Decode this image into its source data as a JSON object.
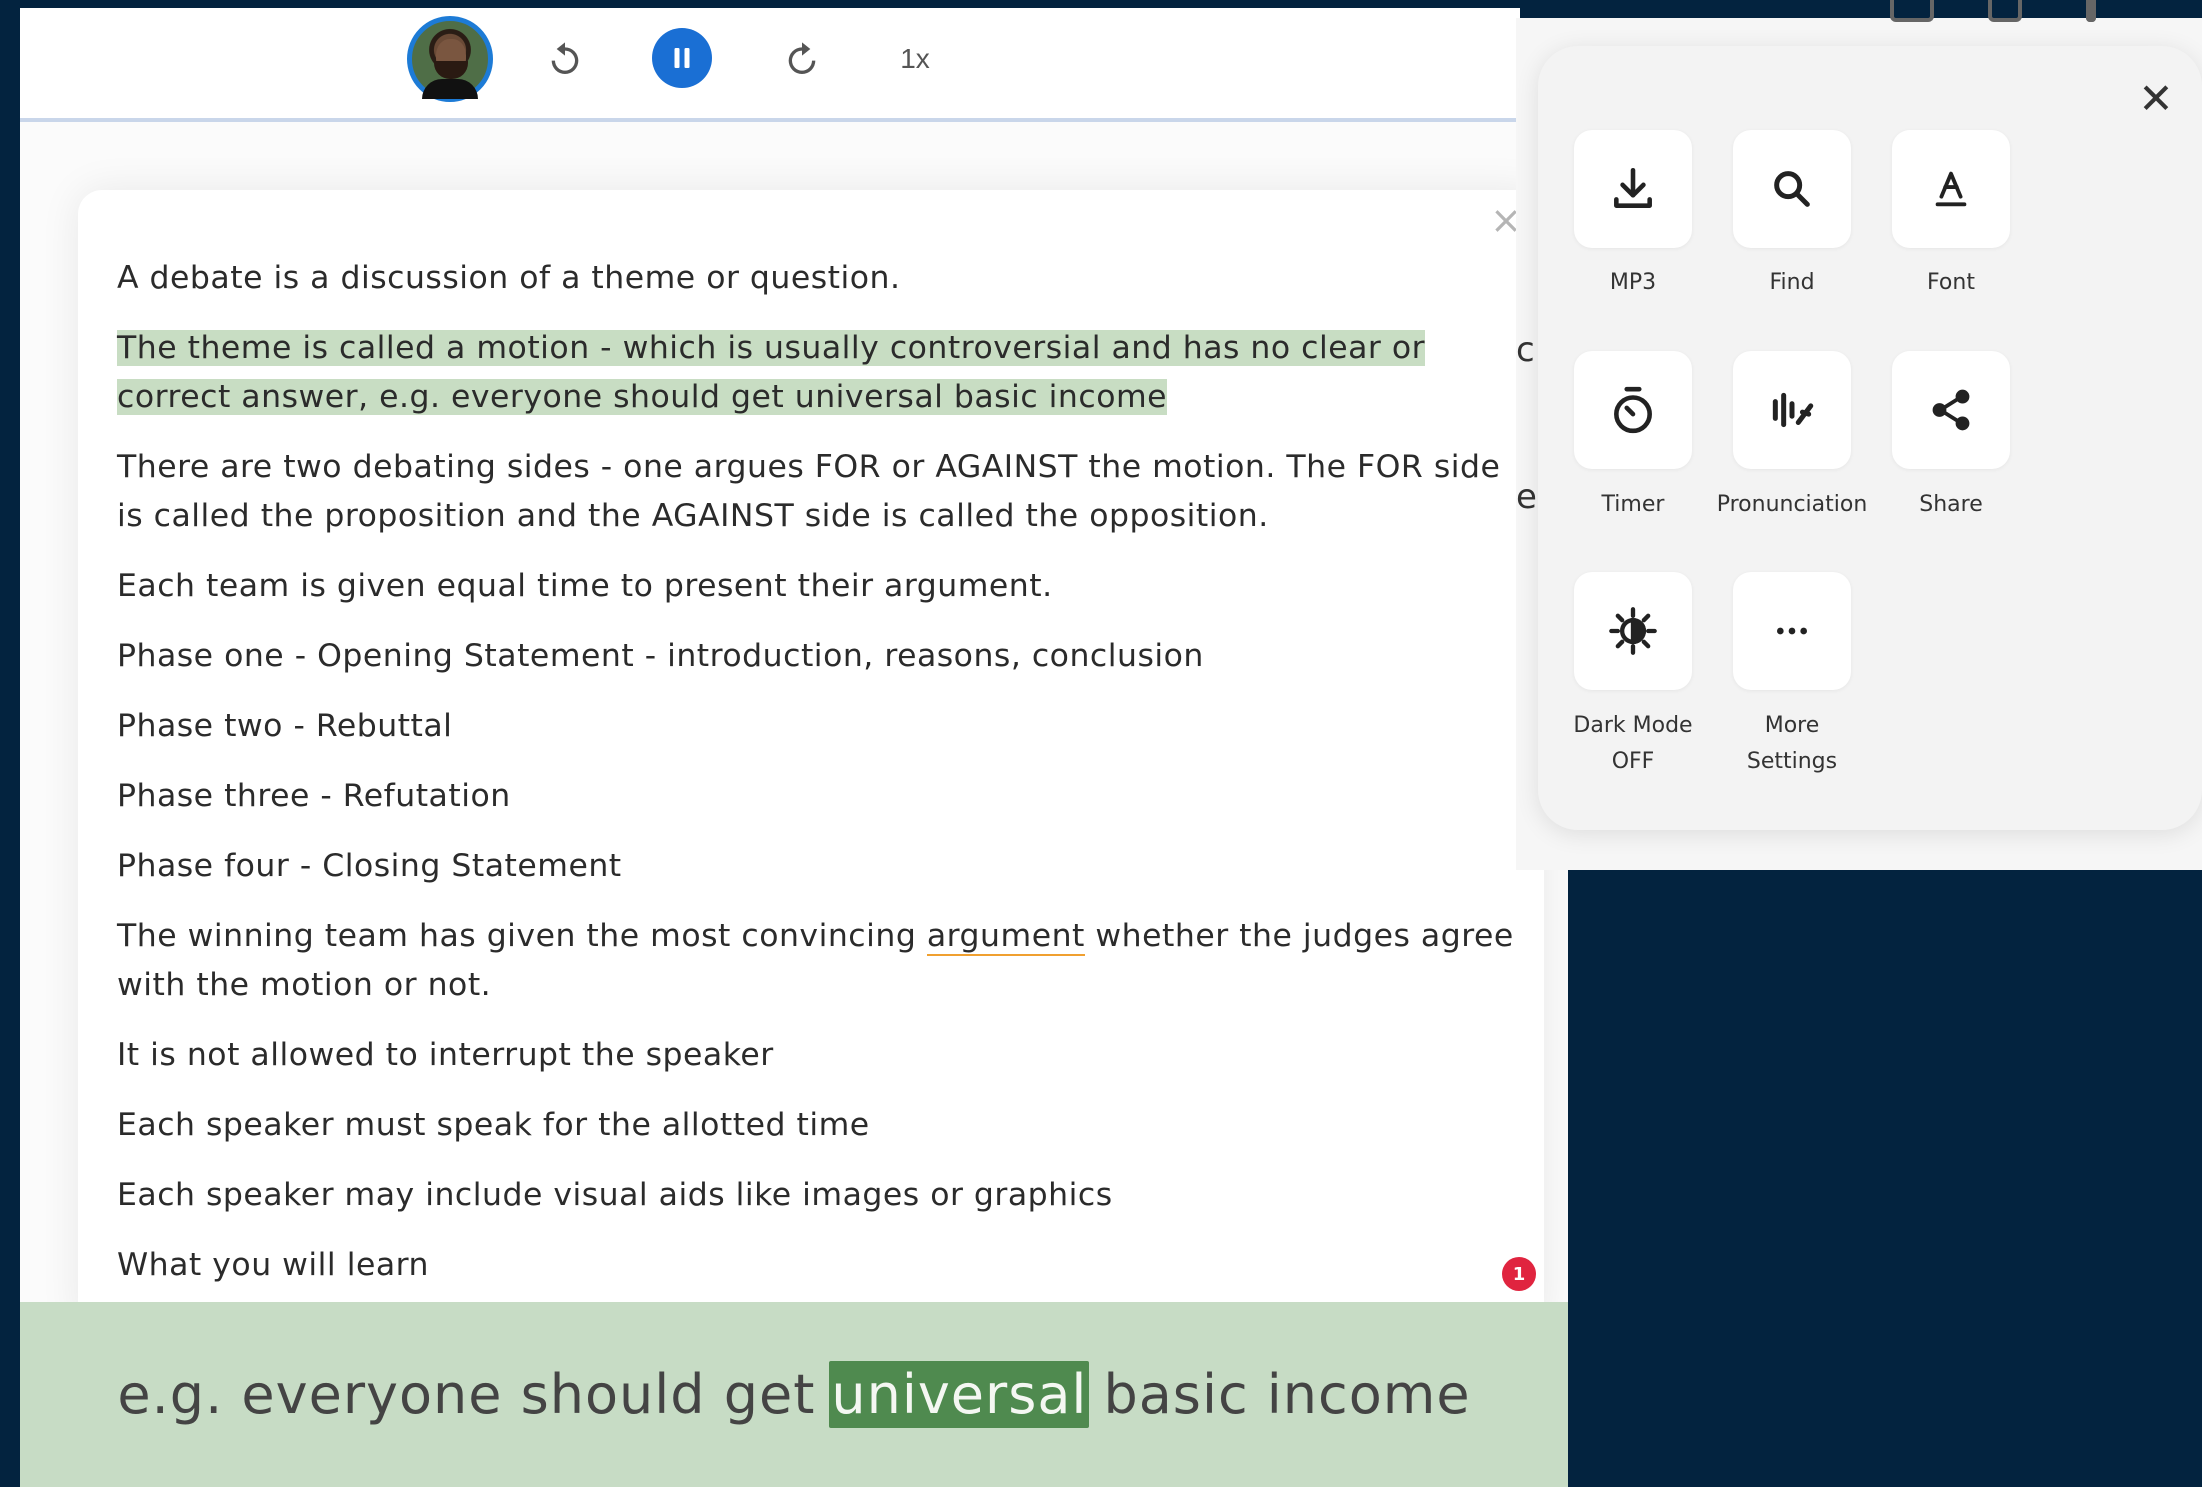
{
  "player": {
    "speed": "1x",
    "rewind": "rewind-icon",
    "play_pause": "pause-icon",
    "forward": "forward-icon"
  },
  "card": {
    "paragraphs": [
      "A debate is a discussion of a theme or question.",
      "The theme is called a motion - which is usually controversial and has no clear or correct answer, e.g. everyone should get universal basic income",
      "There are two debating sides - one argues FOR or AGAINST the motion. The FOR side is called the proposition and the AGAINST side is called the opposition.",
      "Each team is given equal time to present their argument.",
      "Phase one - Opening Statement - introduction, reasons, conclusion",
      "Phase two - Rebuttal",
      "Phase three - Refutation",
      "Phase four - Closing Statement",
      "The winning team has given the most convincing",
      "argument",
      "whether the judges agree with the motion or not.",
      "It is not allowed to interrupt the speaker",
      "Each speaker must speak for the allotted time",
      "Each speaker may include visual aids like images or graphics",
      "What you will learn"
    ],
    "highlight_line1": "The theme is called a motion - which is usually controversial and has no clear or",
    "highlight_line2": "correct answer, e.g. everyone should get universal basic income",
    "notification_count": "1",
    "peek_char_1": "c",
    "peek_char_2": "e"
  },
  "caption": {
    "before": "e.g. everyone should get",
    "current_word": "universal",
    "after": "basic income"
  },
  "panel": {
    "items": [
      {
        "label": "MP3",
        "icon": "download-icon"
      },
      {
        "label": "Find",
        "icon": "search-icon"
      },
      {
        "label": "Font",
        "icon": "font-icon"
      },
      {
        "label": "Timer",
        "icon": "timer-icon"
      },
      {
        "label": "Pronunciation",
        "icon": "pronunciation-icon"
      },
      {
        "label": "Share",
        "icon": "share-icon"
      },
      {
        "label_line1": "Dark Mode",
        "label_line2": "OFF",
        "icon": "dark-mode-icon"
      },
      {
        "label_line1": "More",
        "label_line2": "Settings",
        "icon": "more-icon"
      }
    ]
  },
  "colors": {
    "background": "#03233f",
    "accent_blue": "#1a6fd4",
    "highlight_green": "#c8ddc3",
    "caption_bar": "#c7dcc5",
    "word_highlight": "#4f8a4f",
    "badge_red": "#e0243f"
  }
}
